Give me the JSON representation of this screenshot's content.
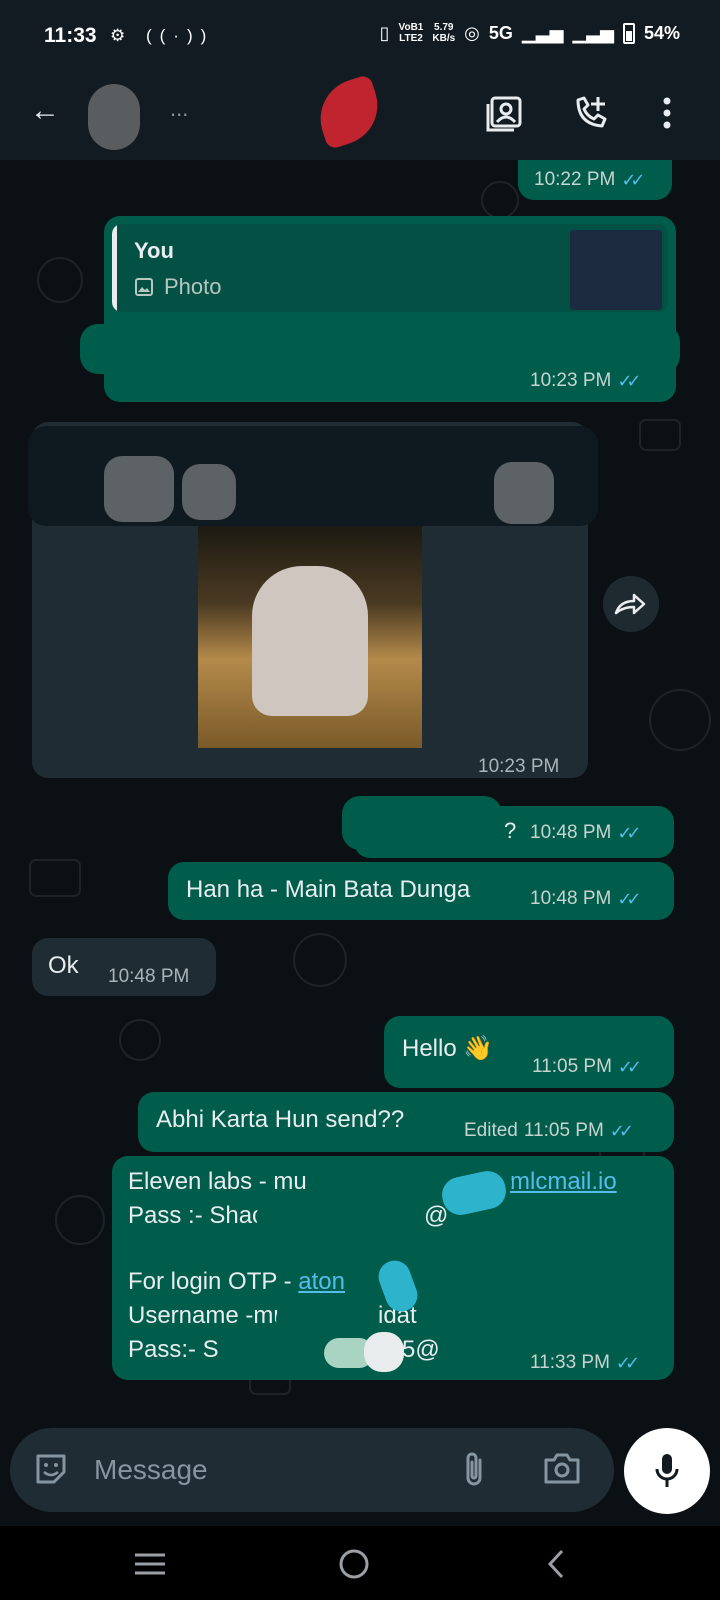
{
  "status_bar": {
    "time": "11:33",
    "network_label_top": "VoB1",
    "network_label_bottom": "LTE2",
    "speed_value": "5.79",
    "speed_unit": "KB/s",
    "network_type": "5G",
    "battery": "54%"
  },
  "header": {
    "contact_name": "...",
    "icons": [
      "back-arrow-icon",
      "contact-card-icon",
      "add-call-icon",
      "more-vertical-icon"
    ]
  },
  "messages": [
    {
      "id": "m1",
      "direction": "out",
      "time": "10:22 PM",
      "status": "read"
    },
    {
      "id": "m2",
      "direction": "out",
      "reply_to": {
        "sender": "You",
        "type_label": "Photo"
      },
      "time": "10:23 PM",
      "status": "read"
    },
    {
      "id": "m3",
      "direction": "in",
      "type": "image",
      "time": "10:23 PM"
    },
    {
      "id": "m4",
      "direction": "out",
      "text": "?",
      "time": "10:48 PM",
      "status": "read"
    },
    {
      "id": "m5",
      "direction": "out",
      "text": "Han ha - Main Bata Dunga",
      "time": "10:48 PM",
      "status": "read"
    },
    {
      "id": "m6",
      "direction": "in",
      "text": "Ok",
      "time": "10:48 PM"
    },
    {
      "id": "m7",
      "direction": "out",
      "text": "Hello 👋",
      "time": "11:05 PM",
      "status": "read"
    },
    {
      "id": "m8",
      "direction": "out",
      "text": "Abhi Karta Hun send??",
      "edited_label": "Edited",
      "time": "11:05 PM",
      "status": "read"
    },
    {
      "id": "m9",
      "direction": "out",
      "lines": {
        "l1_prefix": "Eleven labs - mu",
        "l1_link": "mlcmail.io",
        "l2": "Pass :- Shac",
        "l2_tail": "@",
        "l4_prefix": "For login OTP - ",
        "l4_link": "aton",
        "l5_prefix": "Username -mu",
        "l5_tail": "idat",
        "l6_prefix": "Pass:- S",
        "l6_tail": "5@"
      },
      "time": "11:33 PM",
      "status": "read"
    }
  ],
  "input": {
    "placeholder": "Message"
  },
  "colors": {
    "outgoing_bubble": "#005c4b",
    "incoming_bubble": "#202c33",
    "read_ticks": "#53bdeb",
    "background": "#0b1014"
  }
}
